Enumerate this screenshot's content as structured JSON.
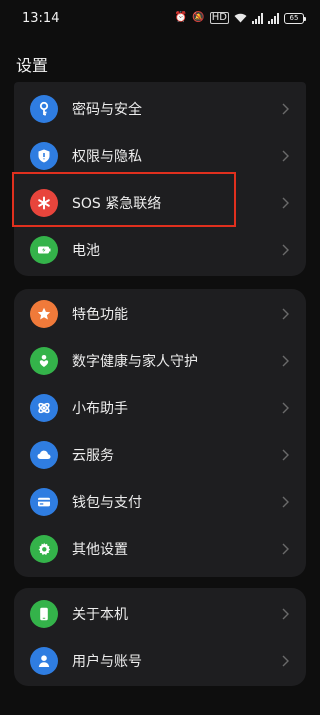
{
  "status_bar": {
    "time": "13:14",
    "battery": "65",
    "hd_label": "HD"
  },
  "page": {
    "title": "设置"
  },
  "groups": [
    {
      "items": [
        {
          "label": "密码与安全",
          "icon": "key-icon",
          "color": "#2f7de1"
        },
        {
          "label": "权限与隐私",
          "icon": "shield-icon",
          "color": "#2f7de1"
        },
        {
          "label": "SOS 紧急联络",
          "icon": "asterisk-icon",
          "color": "#e8453c"
        },
        {
          "label": "电池",
          "icon": "battery-icon",
          "color": "#34b34a"
        }
      ]
    },
    {
      "items": [
        {
          "label": "特色功能",
          "icon": "star-icon",
          "color": "#f07a3a"
        },
        {
          "label": "数字健康与家人守护",
          "icon": "family-heart-icon",
          "color": "#34b34a"
        },
        {
          "label": "小布助手",
          "icon": "assistant-icon",
          "color": "#2f7de1"
        },
        {
          "label": "云服务",
          "icon": "cloud-icon",
          "color": "#2f7de1"
        },
        {
          "label": "钱包与支付",
          "icon": "wallet-icon",
          "color": "#2f7de1"
        },
        {
          "label": "其他设置",
          "icon": "gear-icon",
          "color": "#34b34a"
        }
      ]
    },
    {
      "items": [
        {
          "label": "关于本机",
          "icon": "phone-icon",
          "color": "#34b34a"
        },
        {
          "label": "用户与账号",
          "icon": "user-icon",
          "color": "#2f7de1"
        }
      ]
    }
  ],
  "highlight_color": "#e0301e"
}
